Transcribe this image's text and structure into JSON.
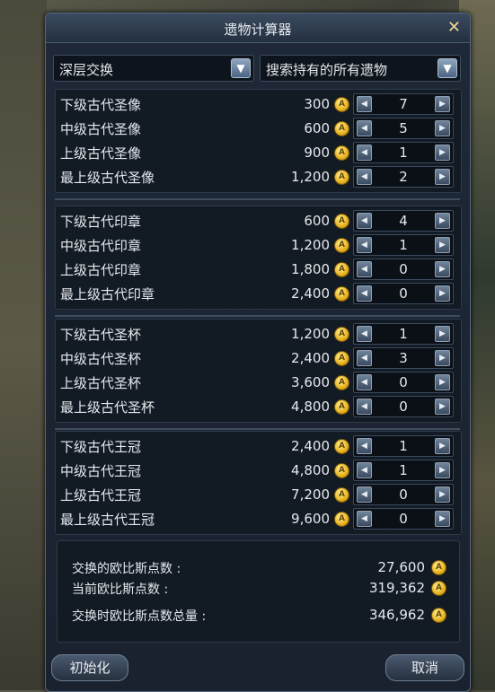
{
  "window": {
    "title": "遗物计算器",
    "close_glyph": "✕"
  },
  "dropdowns": {
    "mode": {
      "label": "深层交换",
      "arrow_icon": "chevron-down-icon"
    },
    "search": {
      "label": "搜索持有的所有遗物",
      "arrow_icon": "chevron-down-icon"
    }
  },
  "stepper_glyphs": {
    "dec": "◀",
    "inc": "▶"
  },
  "coin_glyph": "A",
  "groups": [
    {
      "items": [
        {
          "name": "下级古代圣像",
          "price": "300",
          "qty": "7"
        },
        {
          "name": "中级古代圣像",
          "price": "600",
          "qty": "5"
        },
        {
          "name": "上级古代圣像",
          "price": "900",
          "qty": "1"
        },
        {
          "name": "最上级古代圣像",
          "price": "1,200",
          "qty": "2"
        }
      ]
    },
    {
      "items": [
        {
          "name": "下级古代印章",
          "price": "600",
          "qty": "4"
        },
        {
          "name": "中级古代印章",
          "price": "1,200",
          "qty": "1"
        },
        {
          "name": "上级古代印章",
          "price": "1,800",
          "qty": "0"
        },
        {
          "name": "最上级古代印章",
          "price": "2,400",
          "qty": "0"
        }
      ]
    },
    {
      "items": [
        {
          "name": "下级古代圣杯",
          "price": "1,200",
          "qty": "1"
        },
        {
          "name": "中级古代圣杯",
          "price": "2,400",
          "qty": "3"
        },
        {
          "name": "上级古代圣杯",
          "price": "3,600",
          "qty": "0"
        },
        {
          "name": "最上级古代圣杯",
          "price": "4,800",
          "qty": "0"
        }
      ]
    },
    {
      "items": [
        {
          "name": "下级古代王冠",
          "price": "2,400",
          "qty": "1"
        },
        {
          "name": "中级古代王冠",
          "price": "4,800",
          "qty": "1"
        },
        {
          "name": "上级古代王冠",
          "price": "7,200",
          "qty": "0"
        },
        {
          "name": "最上级古代王冠",
          "price": "9,600",
          "qty": "0"
        }
      ]
    }
  ],
  "summary": {
    "exchange_label": "交换的欧比斯点数 :",
    "exchange_value": "27,600",
    "current_label": "当前欧比斯点数 :",
    "current_value": "319,362",
    "total_label": "交换时欧比斯点数总量 :",
    "total_value": "346,962"
  },
  "buttons": {
    "reset": "初始化",
    "cancel": "取消"
  }
}
